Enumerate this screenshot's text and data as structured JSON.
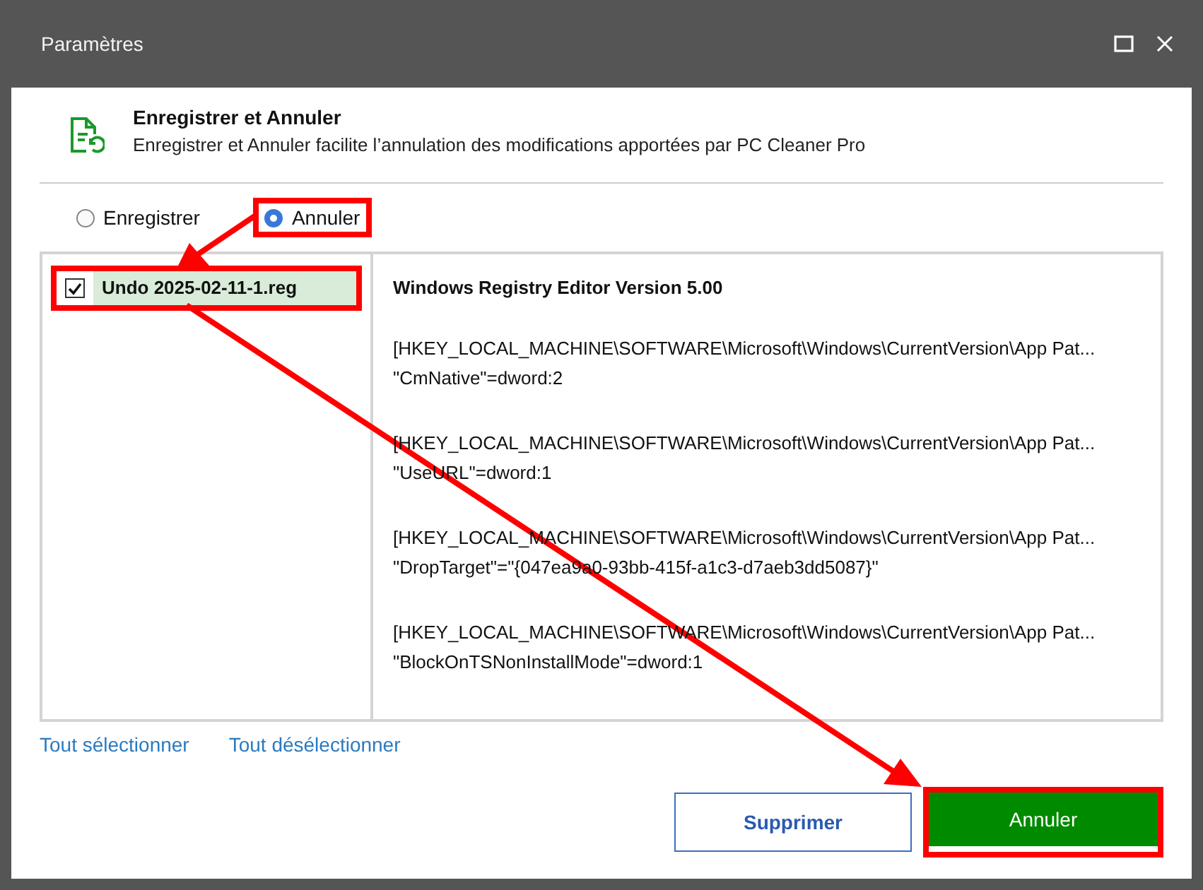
{
  "window": {
    "title": "Paramètres"
  },
  "header": {
    "title": "Enregistrer et Annuler",
    "description": "Enregistrer et Annuler facilite l’annulation des modifications apportées par PC Cleaner Pro"
  },
  "modes": [
    {
      "label": "Enregistrer",
      "selected": false,
      "highlighted": false
    },
    {
      "label": "Annuler",
      "selected": true,
      "highlighted": true
    }
  ],
  "files": [
    {
      "name": "Undo 2025-02-11-1.reg",
      "checked": true,
      "selected": true,
      "highlighted": true
    }
  ],
  "preview": {
    "heading": "Windows Registry Editor Version 5.00",
    "entries": [
      {
        "key": "[HKEY_LOCAL_MACHINE\\SOFTWARE\\Microsoft\\Windows\\CurrentVersion\\App Pat...",
        "value": "\"CmNative\"=dword:2"
      },
      {
        "key": "[HKEY_LOCAL_MACHINE\\SOFTWARE\\Microsoft\\Windows\\CurrentVersion\\App Pat...",
        "value": "\"UseURL\"=dword:1"
      },
      {
        "key": "[HKEY_LOCAL_MACHINE\\SOFTWARE\\Microsoft\\Windows\\CurrentVersion\\App Pat...",
        "value": "\"DropTarget\"=\"{047ea9a0-93bb-415f-a1c3-d7aeb3dd5087}\""
      },
      {
        "key": "[HKEY_LOCAL_MACHINE\\SOFTWARE\\Microsoft\\Windows\\CurrentVersion\\App Pat...",
        "value": "\"BlockOnTSNonInstallMode\"=dword:1"
      }
    ]
  },
  "links": [
    "Tout sélectionner",
    "Tout désélectionner"
  ],
  "buttons": [
    {
      "label": "Supprimer",
      "kind": "secondary",
      "highlighted": false
    },
    {
      "label": "Annuler",
      "kind": "primary",
      "highlighted": true
    }
  ]
}
